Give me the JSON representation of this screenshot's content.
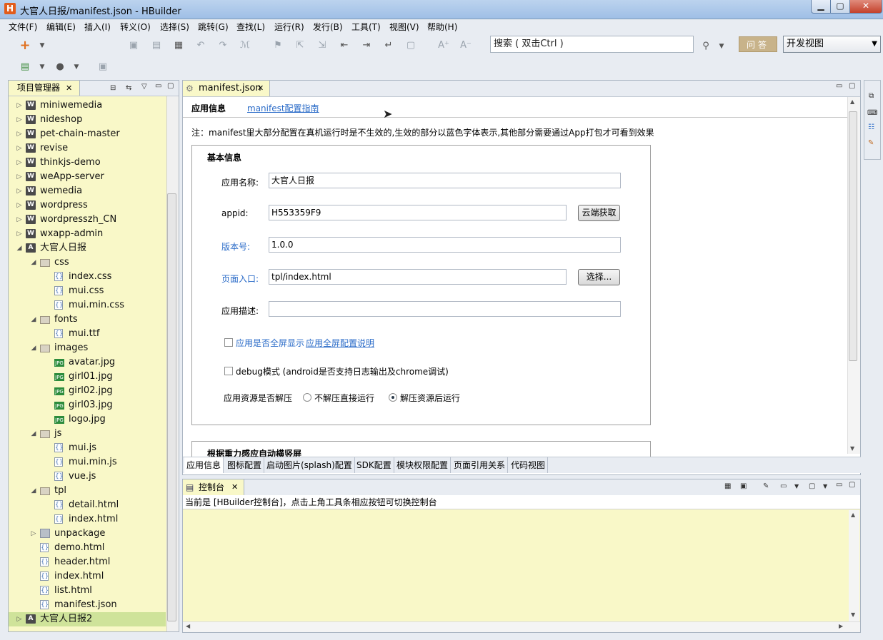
{
  "window": {
    "title": "大官人日报/manifest.json  -  HBuilder",
    "logo": "H",
    "min": "▁",
    "max": "▢",
    "close": "✕"
  },
  "menu": [
    "文件(F)",
    "编辑(E)",
    "插入(I)",
    "转义(O)",
    "选择(S)",
    "跳转(G)",
    "查找(L)",
    "运行(R)",
    "发行(B)",
    "工具(T)",
    "视图(V)",
    "帮助(H)"
  ],
  "toolbar": {
    "search_value": "搜索 ( 双击Ctrl )",
    "qa_label": "问答",
    "view_select": "开发视图"
  },
  "project_panel": {
    "tab_label": "项目管理器",
    "items": [
      {
        "label": "miniwemedia",
        "icon": "w",
        "level": 0,
        "twisty": "▷"
      },
      {
        "label": "nideshop",
        "icon": "w",
        "level": 0,
        "twisty": "▷"
      },
      {
        "label": "pet-chain-master",
        "icon": "w",
        "level": 0,
        "twisty": "▷"
      },
      {
        "label": "revise",
        "icon": "w",
        "level": 0,
        "twisty": "▷"
      },
      {
        "label": "thinkjs-demo",
        "icon": "w",
        "level": 0,
        "twisty": "▷"
      },
      {
        "label": "weApp-server",
        "icon": "w",
        "level": 0,
        "twisty": "▷"
      },
      {
        "label": "wemedia",
        "icon": "w",
        "level": 0,
        "twisty": "▷"
      },
      {
        "label": "wordpress",
        "icon": "w",
        "level": 0,
        "twisty": "▷"
      },
      {
        "label": "wordpresszh_CN",
        "icon": "w",
        "level": 0,
        "twisty": "▷"
      },
      {
        "label": "wxapp-admin",
        "icon": "w",
        "level": 0,
        "twisty": "▷"
      },
      {
        "label": "大官人日报",
        "icon": "a",
        "level": 0,
        "twisty": "◢"
      },
      {
        "label": "css",
        "icon": "folder",
        "level": 1,
        "twisty": "◢"
      },
      {
        "label": "index.css",
        "icon": "file",
        "level": 2,
        "twisty": ""
      },
      {
        "label": "mui.css",
        "icon": "file",
        "level": 2,
        "twisty": ""
      },
      {
        "label": "mui.min.css",
        "icon": "file",
        "level": 2,
        "twisty": ""
      },
      {
        "label": "fonts",
        "icon": "folder",
        "level": 1,
        "twisty": "◢"
      },
      {
        "label": "mui.ttf",
        "icon": "file",
        "level": 2,
        "twisty": ""
      },
      {
        "label": "images",
        "icon": "folder",
        "level": 1,
        "twisty": "◢"
      },
      {
        "label": "avatar.jpg",
        "icon": "img",
        "level": 2,
        "twisty": ""
      },
      {
        "label": "girl01.jpg",
        "icon": "img",
        "level": 2,
        "twisty": ""
      },
      {
        "label": "girl02.jpg",
        "icon": "img",
        "level": 2,
        "twisty": ""
      },
      {
        "label": "girl03.jpg",
        "icon": "img",
        "level": 2,
        "twisty": ""
      },
      {
        "label": "logo.jpg",
        "icon": "img",
        "level": 2,
        "twisty": ""
      },
      {
        "label": "js",
        "icon": "folder",
        "level": 1,
        "twisty": "◢"
      },
      {
        "label": "mui.js",
        "icon": "file",
        "level": 2,
        "twisty": ""
      },
      {
        "label": "mui.min.js",
        "icon": "file",
        "level": 2,
        "twisty": ""
      },
      {
        "label": "vue.js",
        "icon": "file",
        "level": 2,
        "twisty": ""
      },
      {
        "label": "tpl",
        "icon": "folder",
        "level": 1,
        "twisty": "◢"
      },
      {
        "label": "detail.html",
        "icon": "file",
        "level": 2,
        "twisty": ""
      },
      {
        "label": "index.html",
        "icon": "file",
        "level": 2,
        "twisty": ""
      },
      {
        "label": "unpackage",
        "icon": "pkg",
        "level": 1,
        "twisty": "▷"
      },
      {
        "label": "demo.html",
        "icon": "file",
        "level": 1,
        "twisty": ""
      },
      {
        "label": "header.html",
        "icon": "file",
        "level": 1,
        "twisty": ""
      },
      {
        "label": "index.html",
        "icon": "file",
        "level": 1,
        "twisty": ""
      },
      {
        "label": "list.html",
        "icon": "file",
        "level": 1,
        "twisty": ""
      },
      {
        "label": "manifest.json",
        "icon": "file",
        "level": 1,
        "twisty": ""
      },
      {
        "label": "大官人日报2",
        "icon": "a",
        "level": 0,
        "twisty": "▷",
        "selected": true
      }
    ]
  },
  "editor": {
    "tab_label": "manifest.json",
    "section_tab": "应用信息",
    "guide_link": "manifest配置指南",
    "note": "注：manifest里大部分配置在真机运行时是不生效的,生效的部分以蓝色字体表示,其他部分需要通过App打包才可看到效果",
    "basic": {
      "heading": "基本信息",
      "name_label": "应用名称:",
      "name_value": "大官人日报",
      "appid_label": "appid:",
      "appid_value": "H553359F9",
      "cloud_btn": "云端获取",
      "version_label": "版本号:",
      "version_value": "1.0.0",
      "entry_label": "页面入口:",
      "entry_value": "tpl/index.html",
      "choose_btn": "选择...",
      "desc_label": "应用描述:",
      "desc_value": "",
      "fullscreen_label": "应用是否全屏显示",
      "fullscreen_link": "应用全屏配置说明",
      "debug_label": "debug模式 (android是否支持日志输出及chrome调试)",
      "unzip_label": "应用资源是否解压",
      "unzip_opt1": "不解压直接运行",
      "unzip_opt2": "解压资源后运行"
    },
    "gravity_heading": "根据重力感应自动横竖屏",
    "bottom_tabs": [
      "应用信息",
      "图标配置",
      "启动图片(splash)配置",
      "SDK配置",
      "模块权限配置",
      "页面引用关系",
      "代码视图"
    ]
  },
  "console": {
    "tab_label": "控制台",
    "info": "当前是 [HBuilder控制台]，点击上角工具条相应按钮可切换控制台"
  },
  "colors": {
    "accent_blue": "#2a6bc8",
    "panel_yellow": "#f9f8c8",
    "selected_green": "#cfe39a"
  }
}
